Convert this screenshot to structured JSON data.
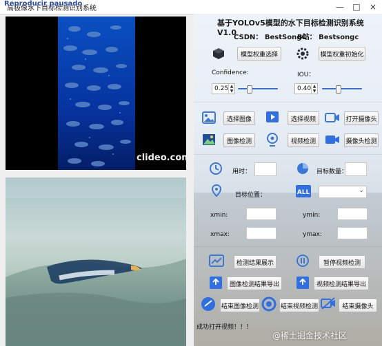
{
  "window": {
    "title": "高极像水下目标检测识别系统",
    "overlay_text": "Reproducir pausado",
    "controls": [
      "minimize-icon",
      "maximize-icon",
      "close-icon"
    ]
  },
  "video": {
    "watermark": "clideo.com"
  },
  "panel": {
    "title": "基于YOLOv5模型的水下目标检测识别系统V1.0",
    "csdn": "CSDN：  BestSongC",
    "bstation": "B站：  Bestsongc",
    "weights_select": "模型权重选择",
    "weights_init": "模型权重初始化",
    "confidence_label": "Confidence:",
    "confidence_value": "0.25",
    "iou_label": "IOU：",
    "iou_value": "0.40",
    "confidence_level": 0.25,
    "iou_level": 0.4
  },
  "buttons": {
    "select_image": "选择图像",
    "select_video": "选择视频",
    "open_camera": "打开摄像头",
    "image_detect": "图像检测",
    "video_detect": "视频检测",
    "camera_detect": "摄像头检测",
    "show_results": "检测结果展示",
    "pause_video": "暂停视频检测",
    "export_image_results": "图像检测结果导出",
    "export_video_results": "视频检测结果导出",
    "end_image_detect": "结束图像检测",
    "end_video_detect": "结束视频检测",
    "end_camera": "结束摄像头"
  },
  "stats": {
    "time_label": "用时：",
    "target_count_label": "目标数量：",
    "target_position_label": "目标位置：",
    "xmin_label": "xmin:",
    "ymin_label": "ymin:",
    "xmax_label": "xmax:",
    "ymax_label": "ymax:",
    "select_value": ""
  },
  "status": {
    "message": "成功打开视频！！！"
  },
  "watermark": "@稀土掘金技术社区",
  "colors": {
    "accent_blue": "#2f6fe2",
    "icon_blue": "#3b78d6"
  }
}
